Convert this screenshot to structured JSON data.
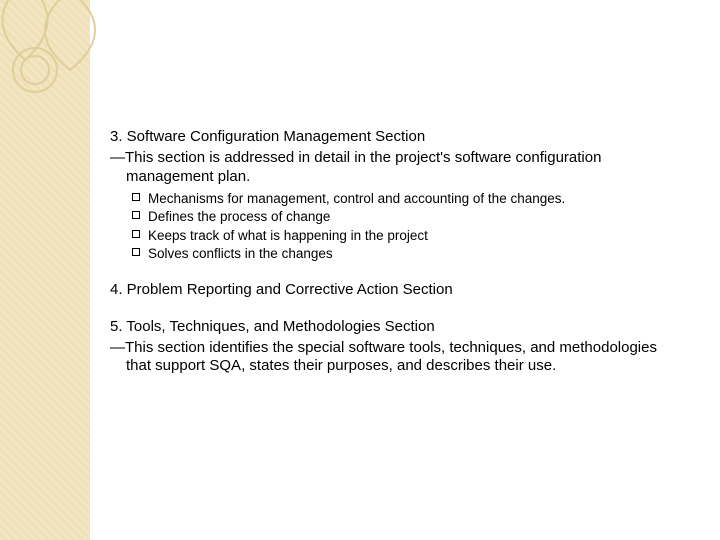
{
  "section3": {
    "title": "3. Software Configuration Management Section",
    "subtitle": "—This section is addressed in detail in the project's software configuration management plan.",
    "bullets": [
      "Mechanisms for management, control and accounting of the changes.",
      "Defines the process of change",
      "Keeps track of what is happening in the project",
      "Solves conflicts in the changes"
    ]
  },
  "section4": {
    "title": "4. Problem Reporting and Corrective Action Section"
  },
  "section5": {
    "title": "5. Tools, Techniques, and Methodologies Section",
    "subtitle": "—This section identifies the special software tools, techniques, and methodologies that support SQA, states their purposes, and describes their use."
  }
}
